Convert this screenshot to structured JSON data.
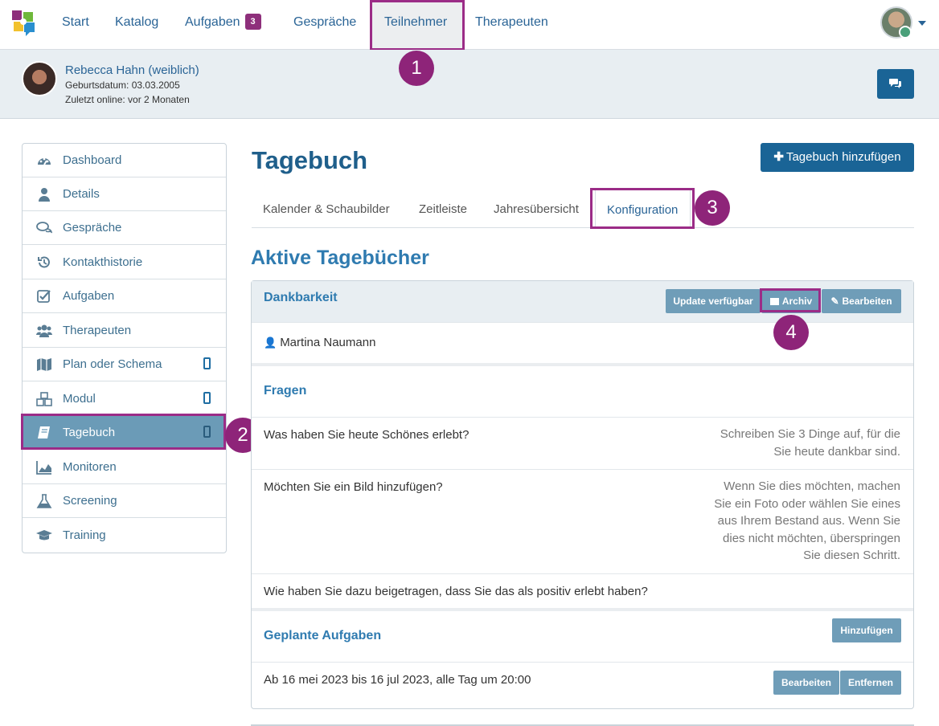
{
  "nav": {
    "items": [
      "Start",
      "Katalog",
      "Aufgaben",
      "Gespräche",
      "Teilnehmer",
      "Therapeuten"
    ],
    "aufgaben_badge": "3",
    "active": "Teilnehmer"
  },
  "markers": [
    "1",
    "2",
    "3",
    "4"
  ],
  "patient": {
    "name": "Rebecca Hahn (weiblich)",
    "birth": "Geburtsdatum: 03.03.2005",
    "last_online": "Zuletzt online: vor 2 Monaten"
  },
  "sidebar": {
    "items": [
      {
        "label": "Dashboard",
        "icon": "dashboard-icon"
      },
      {
        "label": "Details",
        "icon": "user-icon"
      },
      {
        "label": "Gespräche",
        "icon": "comments-icon"
      },
      {
        "label": "Kontakthistorie",
        "icon": "history-icon"
      },
      {
        "label": "Aufgaben",
        "icon": "checkbox-icon"
      },
      {
        "label": "Therapeuten",
        "icon": "users-icon"
      },
      {
        "label": "Plan oder Schema",
        "icon": "map-icon"
      },
      {
        "label": "Modul",
        "icon": "cubes-icon"
      },
      {
        "label": "Tagebuch",
        "icon": "book-icon"
      },
      {
        "label": "Monitoren",
        "icon": "area-chart-icon"
      },
      {
        "label": "Screening",
        "icon": "flask-icon"
      },
      {
        "label": "Training",
        "icon": "graduation-cap-icon"
      }
    ],
    "active": "Tagebuch"
  },
  "main": {
    "title": "Tagebuch",
    "add_button": "Tagebuch hinzufügen",
    "tabs": [
      "Kalender & Schaubilder",
      "Zeitleiste",
      "Jahresübersicht",
      "Konfiguration"
    ],
    "active_tab": "Konfiguration",
    "section_title": "Aktive Tagebücher"
  },
  "diary": {
    "name": "Dankbarkeit",
    "buttons": {
      "update": "Update verfügbar",
      "archive": "Archiv",
      "edit": "Bearbeiten"
    },
    "owner": "Martina Naumann",
    "questions_title": "Fragen",
    "questions": [
      {
        "q": "Was haben Sie heute Schönes erlebt?",
        "hint_lines": [
          "Schreiben Sie 3 Dinge auf, für die",
          "Sie heute dankbar sind."
        ]
      },
      {
        "q": "Möchten Sie ein Bild hinzufügen?",
        "hint_lines": [
          "Wenn Sie dies möchten, machen",
          "Sie ein Foto oder wählen Sie eines",
          "aus Ihrem Bestand aus. Wenn Sie",
          "dies nicht möchten, überspringen",
          "Sie diesen Schritt."
        ]
      },
      {
        "q": "Wie haben Sie dazu beigetragen, dass Sie das als positiv erlebt haben?",
        "hint_lines": []
      }
    ],
    "planned_title": "Geplante Aufgaben",
    "planned_add": "Hinzufügen",
    "schedule": "Ab 16 mei 2023 bis 16 jul 2023, alle Tag um 20:00",
    "schedule_buttons": {
      "edit": "Bearbeiten",
      "remove": "Entfernen"
    }
  },
  "colors": {
    "brand": "#1a6496",
    "highlight": "#9b2c87",
    "marker": "#8e2479",
    "active_side": "#6b9bb7"
  }
}
